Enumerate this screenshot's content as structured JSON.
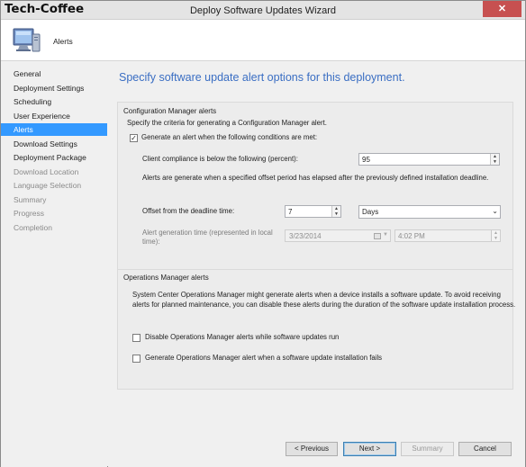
{
  "window": {
    "title": "Deploy Software Updates Wizard",
    "watermark": "Tech-Coffee",
    "close_glyph": "✕"
  },
  "header": {
    "title": "Alerts",
    "icon": "computer-monitor-icon"
  },
  "nav": {
    "items": [
      {
        "label": "General",
        "state": "normal"
      },
      {
        "label": "Deployment Settings",
        "state": "normal"
      },
      {
        "label": "Scheduling",
        "state": "normal"
      },
      {
        "label": "User Experience",
        "state": "normal"
      },
      {
        "label": "Alerts",
        "state": "active"
      },
      {
        "label": "Download Settings",
        "state": "normal"
      },
      {
        "label": "Deployment Package",
        "state": "normal"
      },
      {
        "label": "Download Location",
        "state": "disabled"
      },
      {
        "label": "Language Selection",
        "state": "disabled"
      },
      {
        "label": "Summary",
        "state": "disabled"
      },
      {
        "label": "Progress",
        "state": "disabled"
      },
      {
        "label": "Completion",
        "state": "disabled"
      }
    ]
  },
  "main": {
    "heading": "Specify software update alert options for this deployment.",
    "cm_group": {
      "title": "Configuration Manager alerts",
      "intro": "Specify the criteria for generating a Configuration Manager alert.",
      "generate_alert_label": "Generate an alert when the following conditions are met:",
      "generate_alert_checked": true,
      "compliance_label": "Client compliance is below the following (percent):",
      "compliance_value": "95",
      "offset_info": "Alerts are generate when a specified offset period has elapsed after the previously defined installation deadline.",
      "offset_label": "Offset from the deadline time:",
      "offset_value": "7",
      "offset_unit": "Days",
      "gen_time_label_line1": "Alert generation time (represented in local",
      "gen_time_label_line2": "time):",
      "gen_date": "3/23/2014",
      "gen_time": "4:02 PM"
    },
    "om_group": {
      "title": "Operations Manager alerts",
      "info_line1": "System Center Operations Manager might generate alerts when a device installs a software update. To avoid receiving",
      "info_line2": "alerts for planned maintenance, you can disable these alerts during the duration of the software update installation process.",
      "disable_label": "Disable Operations Manager alerts while software updates run",
      "disable_checked": false,
      "generate_fail_label": "Generate Operations Manager alert when a software update installation fails",
      "generate_fail_checked": false
    }
  },
  "footer": {
    "previous": "< Previous",
    "next": "Next >",
    "summary": "Summary",
    "cancel": "Cancel"
  },
  "colors": {
    "accent": "#3399ff",
    "heading": "#3a6ec3",
    "close": "#c75050"
  }
}
